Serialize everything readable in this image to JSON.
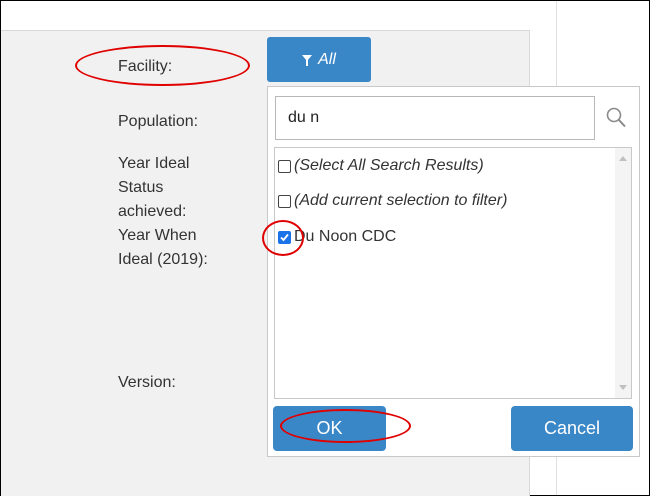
{
  "form": {
    "facility_label": "Facility:",
    "population_label": "Population:",
    "year_ideal_label_lines": [
      "Year Ideal",
      "Status",
      "achieved:",
      "Year When",
      "Ideal (2019):"
    ],
    "version_label": "Version:"
  },
  "filter_button": {
    "label": "All",
    "icon": "funnel-icon"
  },
  "dropdown": {
    "search_value": "du n",
    "search_icon": "magnifier-icon",
    "items": [
      {
        "label": "(Select All Search Results)",
        "checked": false
      },
      {
        "label": "(Add current selection to filter)",
        "checked": false
      },
      {
        "label": "Du Noon CDC",
        "checked": true
      }
    ],
    "ok_label": "OK",
    "cancel_label": "Cancel"
  },
  "colors": {
    "button": "#3a87c8",
    "annotation": "#e00000",
    "checkbox": "#1a73e8"
  }
}
